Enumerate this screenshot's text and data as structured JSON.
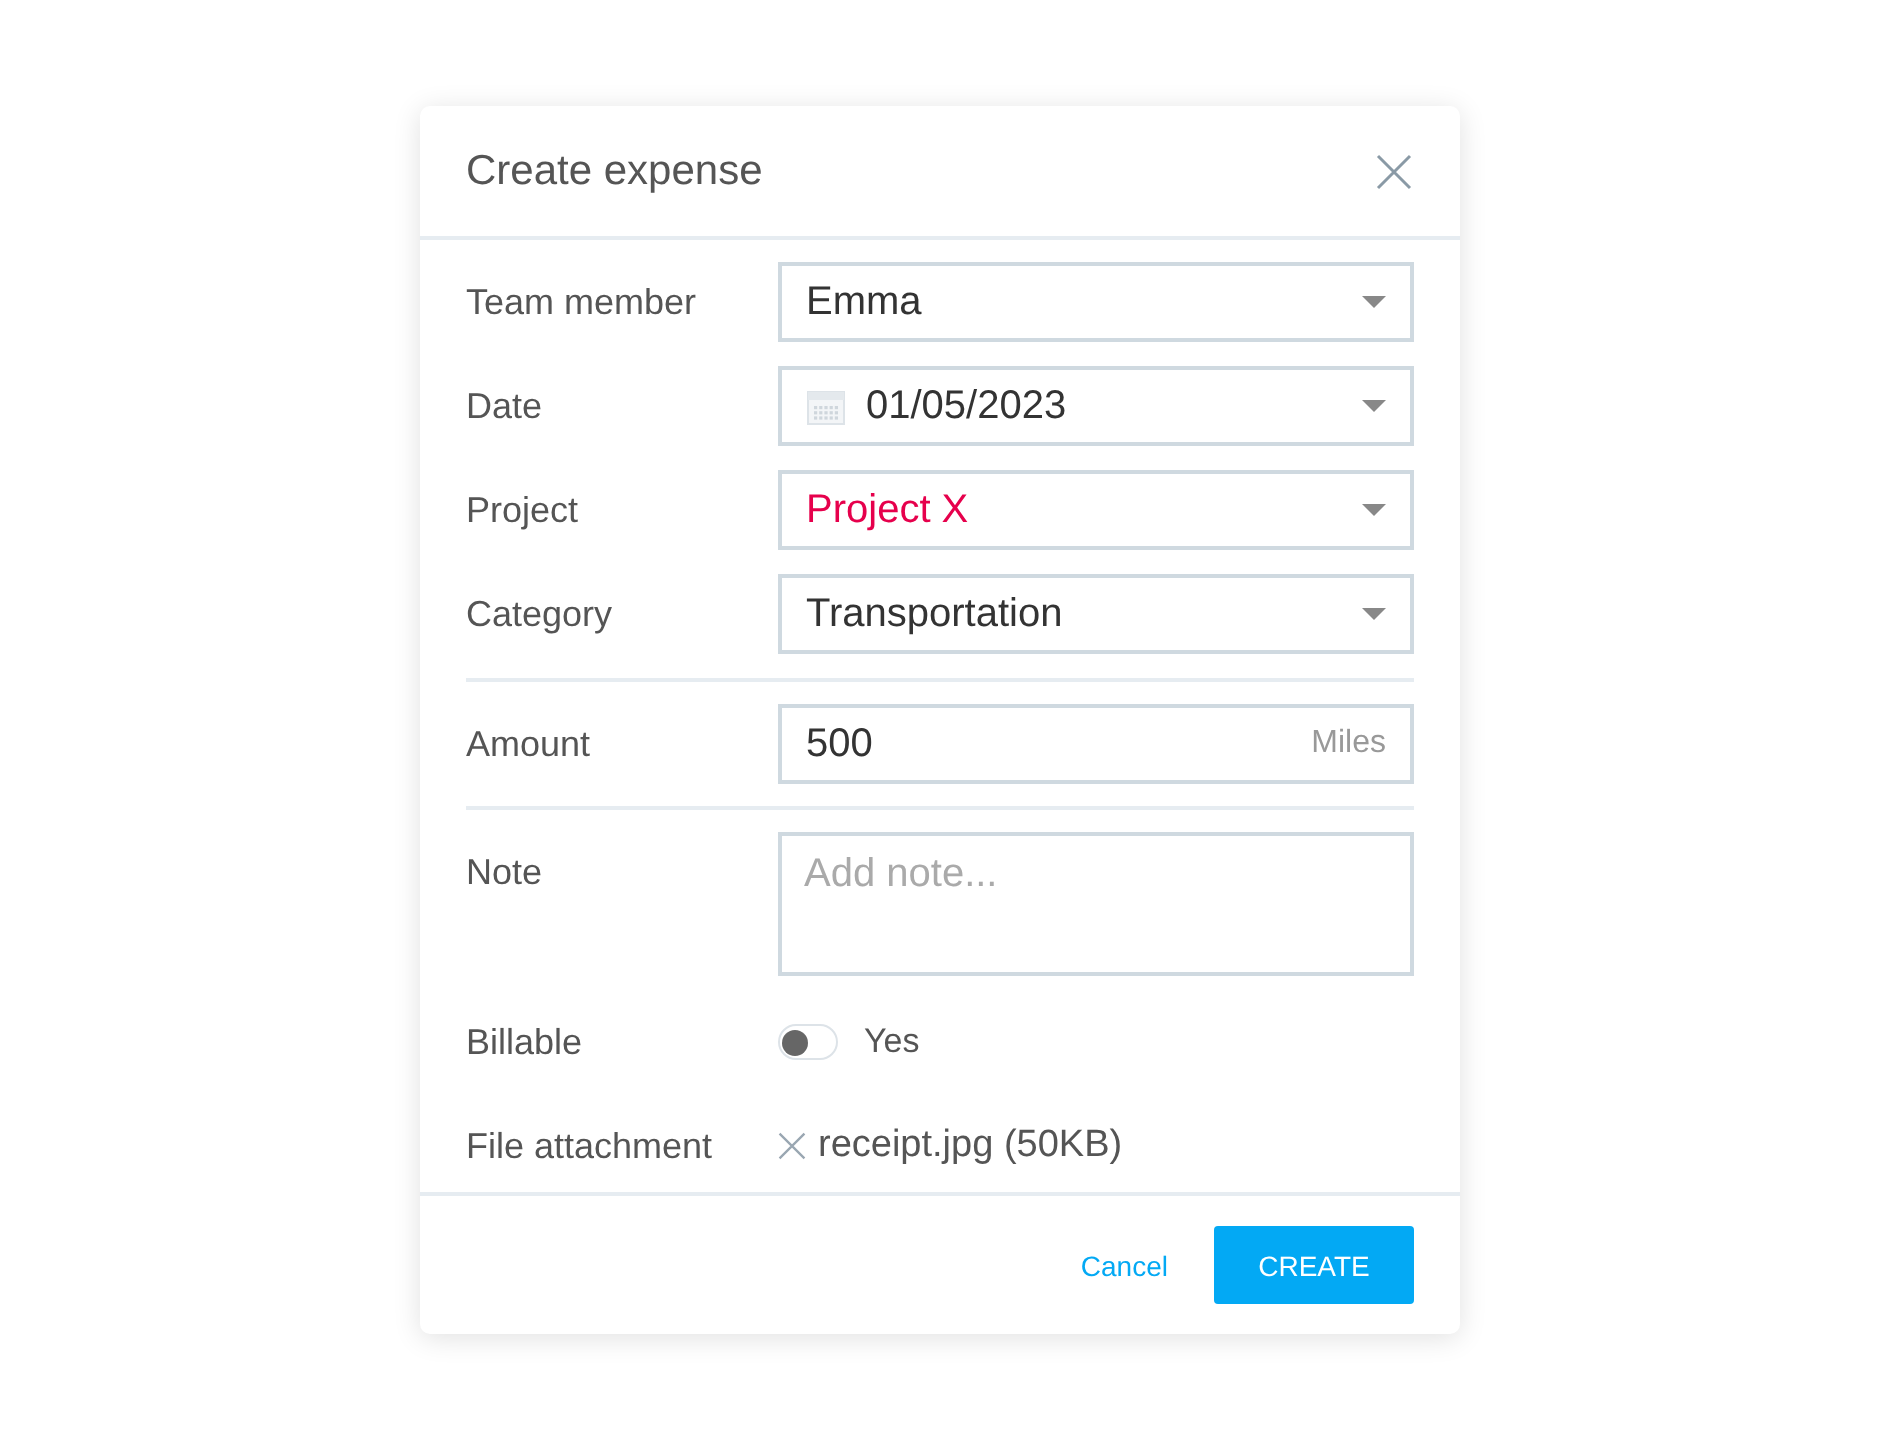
{
  "dialog": {
    "title": "Create expense",
    "fields": [
      {
        "kind": "select",
        "label": "Team member",
        "value": "Emma"
      },
      {
        "kind": "date",
        "label": "Date",
        "value": "01/05/2023"
      },
      {
        "kind": "select",
        "label": "Project",
        "value": "Project X",
        "color": "#e6004c"
      },
      {
        "kind": "select",
        "label": "Category",
        "value": "Transportation"
      },
      {
        "kind": "amount",
        "label": "Amount",
        "value": "500",
        "unit": "Miles"
      },
      {
        "kind": "note",
        "label": "Note",
        "placeholder": "Add note..."
      },
      {
        "kind": "toggle",
        "label": "Billable",
        "on": false,
        "text": "Yes"
      },
      {
        "kind": "file",
        "label": "File attachment",
        "file": "receipt.jpg (50KB)"
      }
    ],
    "buttons": [
      {
        "kind": "text",
        "label": "Cancel"
      },
      {
        "kind": "primary",
        "label": "CREATE"
      }
    ]
  }
}
